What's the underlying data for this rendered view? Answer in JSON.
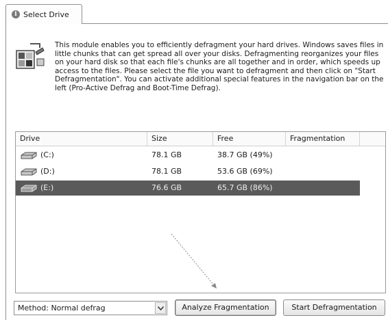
{
  "tab": {
    "label": "Select Drive",
    "icon": "info-icon"
  },
  "description": "This module enables you to efficiently defragment your hard drives. Windows saves files in little chunks that can get spread all over your disks. Defragmenting reorganizes your files on your hard disk so that each file's chunks are all together and in order, which speeds up access to the files. Please select the file you want to defragment and then click on \"Start Defragmentation\". You can activate additional special features in the navigation bar on the left (Pro-Active Defrag and Boot-Time Defrag).",
  "table": {
    "columns": [
      "Drive",
      "Size",
      "Free",
      "Fragmentation"
    ],
    "rows": [
      {
        "drive": "(C:)",
        "size": "78.1 GB",
        "free": "38.7 GB (49%)",
        "fragmentation": "",
        "selected": false
      },
      {
        "drive": "(D:)",
        "size": "78.1 GB",
        "free": "53.6 GB (69%)",
        "fragmentation": "",
        "selected": false
      },
      {
        "drive": "(E:)",
        "size": "76.6 GB",
        "free": "65.7 GB (86%)",
        "fragmentation": "",
        "selected": true
      }
    ]
  },
  "controls": {
    "method": "Method: Normal defrag",
    "analyze_label": "Analyze Fragmentation",
    "start_label": "Start Defragmentation"
  },
  "colors": {
    "selection": "#5a5a5a",
    "border": "#8f8f8f"
  }
}
